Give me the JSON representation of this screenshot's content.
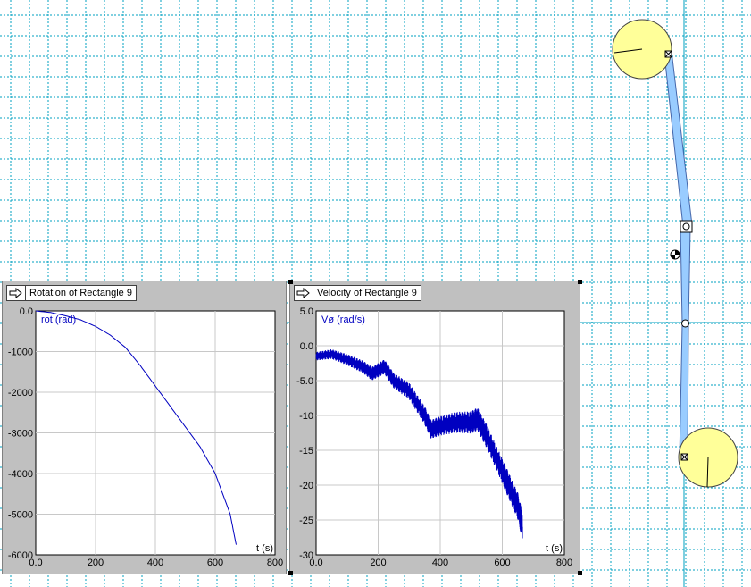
{
  "meters": {
    "rotation": {
      "title": "Rotation of Rectangle 9",
      "ylabel": "rot (rad)",
      "xlabel": "t (s)",
      "x_ticks": [
        "0.0",
        "200",
        "400",
        "600",
        "800"
      ],
      "y_ticks": [
        "0.0",
        "-1000",
        "-2000",
        "-3000",
        "-4000",
        "-5000",
        "-6000"
      ]
    },
    "velocity": {
      "title": "Velocity of Rectangle 9",
      "ylabel": "Vø (rad/s)",
      "xlabel": "t (s)",
      "x_ticks": [
        "0.0",
        "200",
        "400",
        "600",
        "800"
      ],
      "y_ticks": [
        "5.0",
        "0.0",
        "-5.0",
        "-10",
        "-15",
        "-20",
        "-25",
        "-30"
      ]
    }
  },
  "colors": {
    "grid": "#00a0c0",
    "series": "#0000c0",
    "pendulum_disc": "#ffff99",
    "pendulum_rod": "#99ccff"
  },
  "chart_data": [
    {
      "type": "line",
      "title": "Rotation of Rectangle 9",
      "xlabel": "t (s)",
      "ylabel": "rot (rad)",
      "xlim": [
        0,
        800
      ],
      "ylim": [
        -6000,
        0
      ],
      "x": [
        0,
        50,
        100,
        150,
        200,
        250,
        300,
        350,
        400,
        450,
        500,
        550,
        600,
        650,
        670
      ],
      "y": [
        0,
        -40,
        -120,
        -220,
        -380,
        -600,
        -900,
        -1350,
        -1850,
        -2350,
        -2850,
        -3350,
        -4000,
        -5000,
        -5750
      ]
    },
    {
      "type": "line",
      "title": "Velocity of Rectangle 9",
      "xlabel": "t (s)",
      "ylabel": "Vø (rad/s)",
      "xlim": [
        0,
        800
      ],
      "ylim": [
        -30,
        5
      ],
      "x": [
        0,
        50,
        100,
        150,
        180,
        200,
        220,
        250,
        300,
        350,
        370,
        400,
        450,
        500,
        520,
        550,
        600,
        620,
        650,
        665
      ],
      "y": [
        -1.5,
        -1.2,
        -2,
        -3,
        -4,
        -3.5,
        -3,
        -5,
        -6.5,
        -10,
        -12,
        -11.5,
        -11,
        -11,
        -10.5,
        -13,
        -18,
        -20,
        -23,
        -26
      ]
    }
  ]
}
